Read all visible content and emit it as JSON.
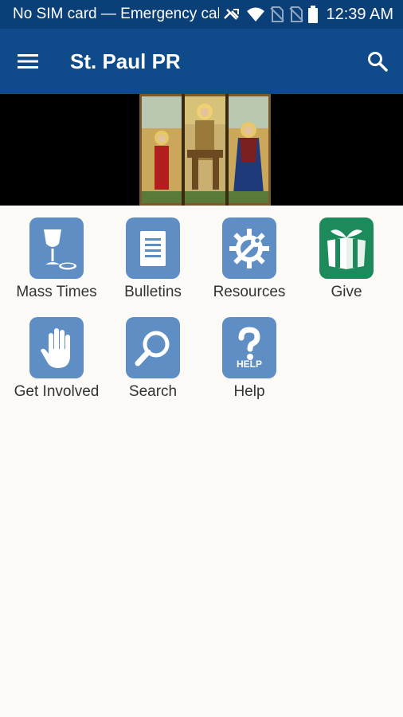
{
  "status_bar": {
    "text": "No SIM card — Emergency calls only",
    "time": "12:39 AM",
    "icons": [
      "no-signal-icon",
      "wifi-icon",
      "sim-off-icon",
      "sim-off-icon",
      "battery-icon"
    ]
  },
  "app_bar": {
    "title": "St. Paul PR",
    "menu_icon": "hamburger-menu-icon",
    "search_icon": "search-icon"
  },
  "banner": {
    "image": "stained-glass-holy-family"
  },
  "tiles": [
    {
      "label": "Mass Times",
      "icon": "chalice-host-icon",
      "color": "#5e8ec4"
    },
    {
      "label": "Bulletins",
      "icon": "document-icon",
      "color": "#5e8ec4"
    },
    {
      "label": "Resources",
      "icon": "gear-wrench-icon",
      "color": "#5e8ec4"
    },
    {
      "label": "Give",
      "icon": "gift-box-icon",
      "color": "#1c8a5a"
    },
    {
      "label": "Get Involved",
      "icon": "raised-hand-icon",
      "color": "#5e8ec4"
    },
    {
      "label": "Search",
      "icon": "magnifier-icon",
      "color": "#5e8ec4"
    },
    {
      "label": "Help",
      "icon": "question-help-icon",
      "color": "#5e8ec4",
      "badge": "HELP"
    }
  ]
}
